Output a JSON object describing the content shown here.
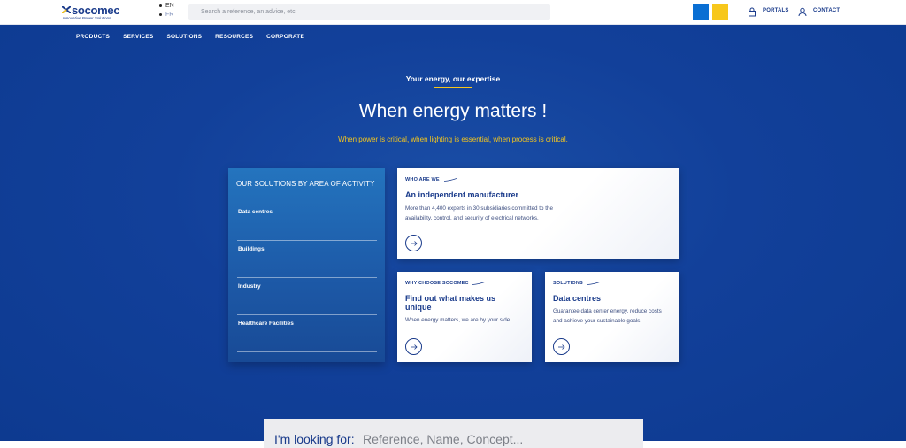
{
  "header": {
    "brand": "socomec",
    "tagline": "Innovative Power Solutions",
    "languages": [
      "EN",
      "FR"
    ],
    "search_placeholder": "Search a reference, an advice, etc.",
    "portals_label": "PORTALS",
    "contact_label": "CONTACT",
    "colors": {
      "blue_square": "#0a6fd3",
      "yellow_square": "#f7c71b"
    }
  },
  "nav": {
    "items": [
      "PRODUCTS",
      "SERVICES",
      "SOLUTIONS",
      "RESOURCES",
      "CORPORATE"
    ]
  },
  "hero": {
    "kicker": "Your energy, our expertise",
    "headline": "When energy matters !",
    "subline": "When power is critical, when lighting is essential, when process is critical."
  },
  "solutions_panel": {
    "title": "OUR SOLUTIONS BY AREA OF ACTIVITY",
    "items": [
      "Data centres",
      "Buildings",
      "Industry",
      "Healthcare Facilities"
    ]
  },
  "cards": [
    {
      "kicker": "WHO ARE WE",
      "title": "An independent manufacturer",
      "desc_line1": "More than 4,400 experts in 30 subsidiaries committed to the",
      "desc_line2": "availability, control, and security of electrical networks."
    },
    {
      "kicker": "WHY CHOOSE SOCOMEC",
      "title_line1": "Find out what makes us",
      "title_line2": "unique",
      "desc_line1": "When energy matters, we are by your side."
    },
    {
      "kicker": "SOLUTIONS",
      "title": "Data centres",
      "desc_line1": "Guarantee data center energy, reduce costs",
      "desc_line2": "and achieve your sustainable goals."
    }
  ],
  "lookbar": {
    "label": "I'm looking for:",
    "placeholder": "Reference, Name, Concept..."
  }
}
